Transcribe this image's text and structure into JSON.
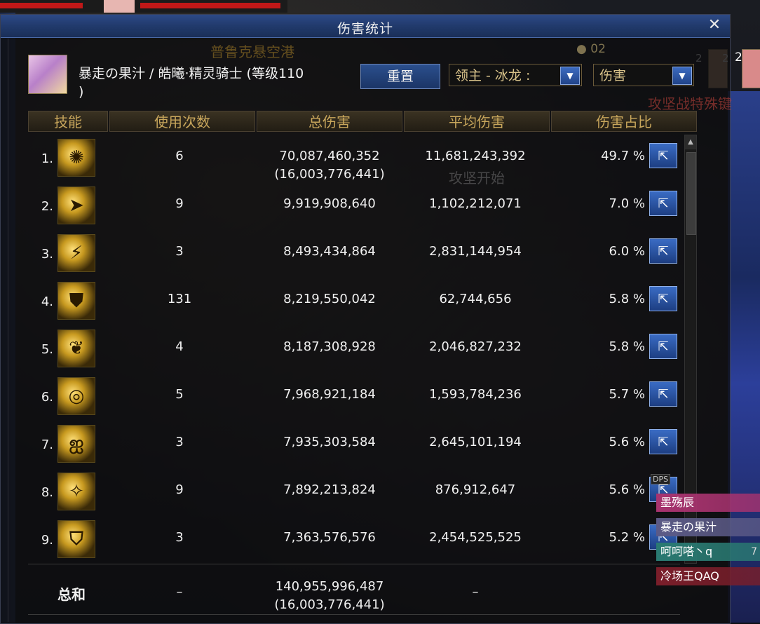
{
  "window": {
    "title": "伤害统计",
    "close_icon": "close-icon"
  },
  "scene": {
    "location": "普鲁克悬空港",
    "coins": "02",
    "event1": "攻坚战特殊键",
    "event2": "攻坚开始"
  },
  "right_portraits": {
    "left_num": "2",
    "mid_num": "2",
    "right_num": "2"
  },
  "header": {
    "character_name": "暴走の果汁 / 皓曦·精灵骑士 (等级110\n)",
    "reset_label": "重置",
    "boss_select": "领主 - 冰龙 :",
    "type_select": "伤害"
  },
  "columns": [
    "技能",
    "使用次数",
    "总伤害",
    "平均伤害",
    "伤害占比"
  ],
  "rows": [
    {
      "index": "1.",
      "uses": "6",
      "total": "70,087,460,352",
      "total_sub": "(16,003,776,441)",
      "avg": "11,681,243,392",
      "pct": "49.7 %"
    },
    {
      "index": "2.",
      "uses": "9",
      "total": "9,919,908,640",
      "total_sub": "",
      "avg": "1,102,212,071",
      "pct": "7.0 %"
    },
    {
      "index": "3.",
      "uses": "3",
      "total": "8,493,434,864",
      "total_sub": "",
      "avg": "2,831,144,954",
      "pct": "6.0 %"
    },
    {
      "index": "4.",
      "uses": "131",
      "total": "8,219,550,042",
      "total_sub": "",
      "avg": "62,744,656",
      "pct": "5.8 %"
    },
    {
      "index": "5.",
      "uses": "4",
      "total": "8,187,308,928",
      "total_sub": "",
      "avg": "2,046,827,232",
      "pct": "5.8 %"
    },
    {
      "index": "6.",
      "uses": "5",
      "total": "7,968,921,184",
      "total_sub": "",
      "avg": "1,593,784,236",
      "pct": "5.7 %"
    },
    {
      "index": "7.",
      "uses": "3",
      "total": "7,935,303,584",
      "total_sub": "",
      "avg": "2,645,101,194",
      "pct": "5.6 %"
    },
    {
      "index": "8.",
      "uses": "9",
      "total": "7,892,213,824",
      "total_sub": "",
      "avg": "876,912,647",
      "pct": "5.6 %"
    },
    {
      "index": "9.",
      "uses": "3",
      "total": "7,363,576,576",
      "total_sub": "",
      "avg": "2,454,525,525",
      "pct": "5.2 %"
    }
  ],
  "total_row": {
    "label": "总和",
    "uses": "–",
    "total": "140,955,996,487",
    "total_sub": "(16,003,776,441)",
    "avg": "–"
  },
  "dps_panel": {
    "tag": "DPS",
    "items": [
      {
        "name": "墨殇辰",
        "color": "#a8336f",
        "value": ""
      },
      {
        "name": "暴走の果汁",
        "color": "#5b5a86",
        "value": ""
      },
      {
        "name": "呵呵嗒丶q",
        "color": "#2a7a72",
        "value": "7"
      },
      {
        "name": "冷场王QAQ",
        "color": "#7a1e2a",
        "value": ""
      }
    ]
  }
}
